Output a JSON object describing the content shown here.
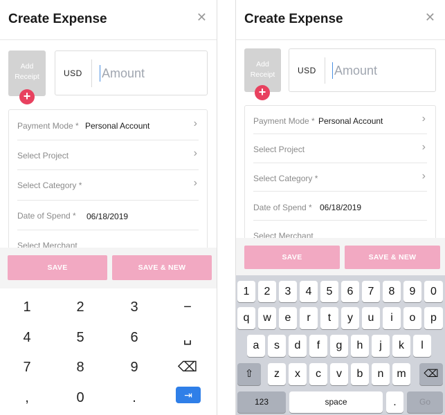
{
  "screen": {
    "title": "Create Expense",
    "close_glyph": "✕",
    "receipt_label_line1": "Add",
    "receipt_label_line2": "Receipt",
    "plus_glyph": "+",
    "currency": "USD",
    "amount_placeholder": "Amount",
    "fields": [
      {
        "label": "Payment Mode *",
        "value": "Personal Account",
        "chevron": true
      },
      {
        "label": "Select Project",
        "value": "",
        "chevron": true
      },
      {
        "label": "Select Category *",
        "value": "",
        "chevron": true
      },
      {
        "label": "Date of Spend *",
        "value": "06/18/2019",
        "chevron": false
      },
      {
        "label": "Select Merchant",
        "value": "",
        "chevron": false
      }
    ],
    "chevron_glyph": "›",
    "save_label": "SAVE",
    "save_new_label": "SAVE & NEW",
    "brand_pink": "#f2a9c2",
    "plus_red": "#e8415f"
  },
  "numpad": {
    "keys": [
      "1",
      "2",
      "3",
      "−",
      "4",
      "5",
      "6",
      "␣",
      "7",
      "8",
      "9",
      "⌫",
      ",",
      "0",
      ".",
      "⇥"
    ]
  },
  "keyboard": {
    "row_numbers": [
      "1",
      "2",
      "3",
      "4",
      "5",
      "6",
      "7",
      "8",
      "9",
      "0"
    ],
    "row1": [
      "q",
      "w",
      "e",
      "r",
      "t",
      "y",
      "u",
      "i",
      "o",
      "p"
    ],
    "row2": [
      "a",
      "s",
      "d",
      "f",
      "g",
      "h",
      "j",
      "k",
      "l"
    ],
    "row3": [
      "z",
      "x",
      "c",
      "v",
      "b",
      "n",
      "m"
    ],
    "shift": "⇧",
    "delete": "⌫",
    "numbers_key": "123",
    "space_key": "space",
    "period_key": ".",
    "go_key": "Go"
  }
}
